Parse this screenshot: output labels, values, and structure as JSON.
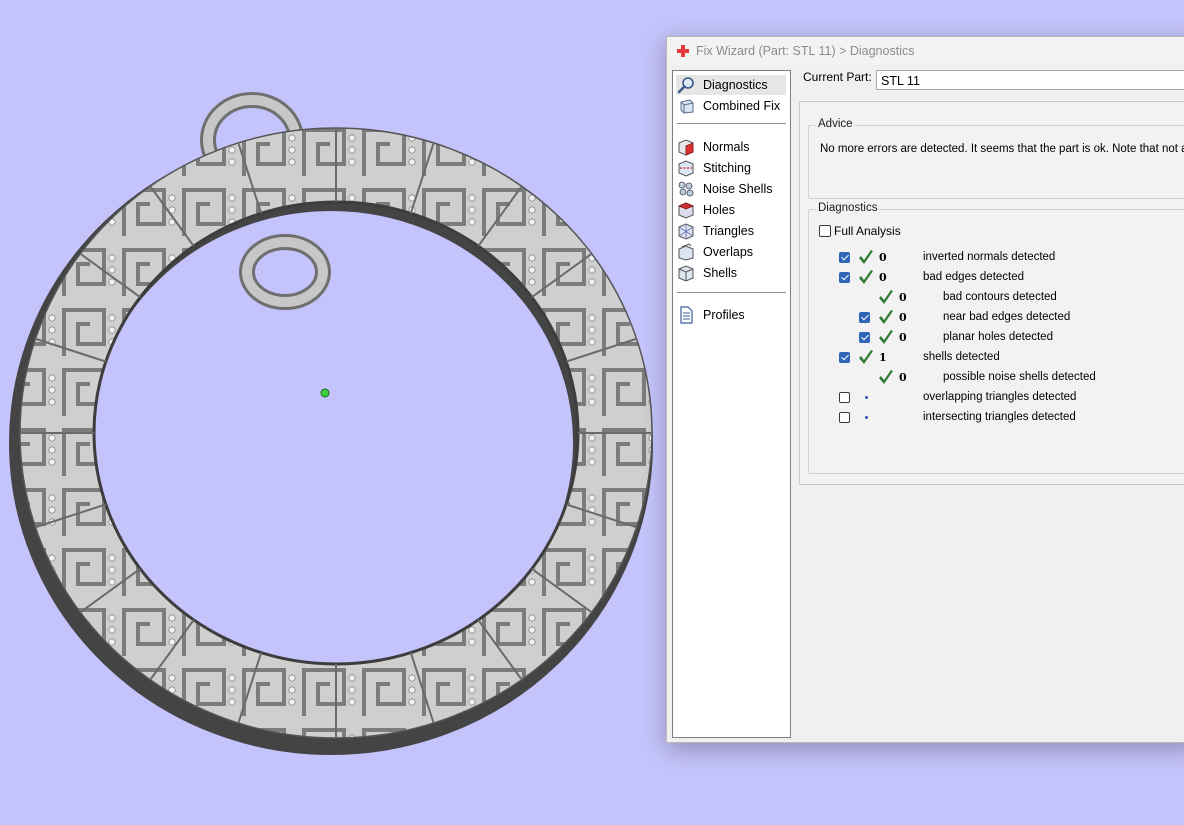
{
  "window": {
    "title": "Fix Wizard (Part: STL 11) > Diagnostics",
    "current_part_label": "Current Part:",
    "current_part_value": "STL 11"
  },
  "nav": {
    "items": [
      {
        "label": "Diagnostics",
        "icon": "diagnostics-magnifier-icon",
        "selected": true
      },
      {
        "label": "Combined Fix",
        "icon": "combined-fix-icon"
      },
      {
        "label": "Normals",
        "icon": "normals-icon"
      },
      {
        "label": "Stitching",
        "icon": "stitching-icon"
      },
      {
        "label": "Noise Shells",
        "icon": "noise-shells-icon"
      },
      {
        "label": "Holes",
        "icon": "holes-icon"
      },
      {
        "label": "Triangles",
        "icon": "triangles-icon"
      },
      {
        "label": "Overlaps",
        "icon": "overlaps-icon"
      },
      {
        "label": "Shells",
        "icon": "shells-icon"
      },
      {
        "label": "Profiles",
        "icon": "profiles-document-icon"
      }
    ]
  },
  "advice": {
    "title": "Advice",
    "text": "No more errors are detected. It seems that the part is ok. Note that not all"
  },
  "diagnostics": {
    "title": "Diagnostics",
    "full_analysis_label": "Full Analysis",
    "full_analysis_checked": false,
    "rows": [
      {
        "checkbox": "checked",
        "status": "ok",
        "count": "0",
        "label": "inverted normals detected",
        "indent": 0
      },
      {
        "checkbox": "checked",
        "status": "ok",
        "count": "0",
        "label": "bad edges detected",
        "indent": 0
      },
      {
        "checkbox": "none",
        "status": "ok",
        "count": "0",
        "label": "bad contours detected",
        "indent": 1
      },
      {
        "checkbox": "checked",
        "status": "ok",
        "count": "0",
        "label": "near bad edges detected",
        "indent": 1
      },
      {
        "checkbox": "checked",
        "status": "ok",
        "count": "0",
        "label": "planar holes detected",
        "indent": 1
      },
      {
        "checkbox": "checked",
        "status": "ok",
        "count": "1",
        "label": "shells detected",
        "indent": 0
      },
      {
        "checkbox": "none",
        "status": "ok",
        "count": "0",
        "label": "possible noise shells detected",
        "indent": 1
      },
      {
        "checkbox": "unchecked",
        "status": "pending",
        "count": "",
        "label": "overlapping triangles detected",
        "indent": 0
      },
      {
        "checkbox": "unchecked",
        "status": "pending",
        "count": "",
        "label": "intersecting triangles detected",
        "indent": 0
      }
    ]
  },
  "colors": {
    "viewport_background": "#c4c3fb",
    "model_grey": "#c8c8c8",
    "check_green": "#2e7d32",
    "checkbox_blue": "#2e65b6",
    "app_icon_red": "#e23b3b"
  }
}
